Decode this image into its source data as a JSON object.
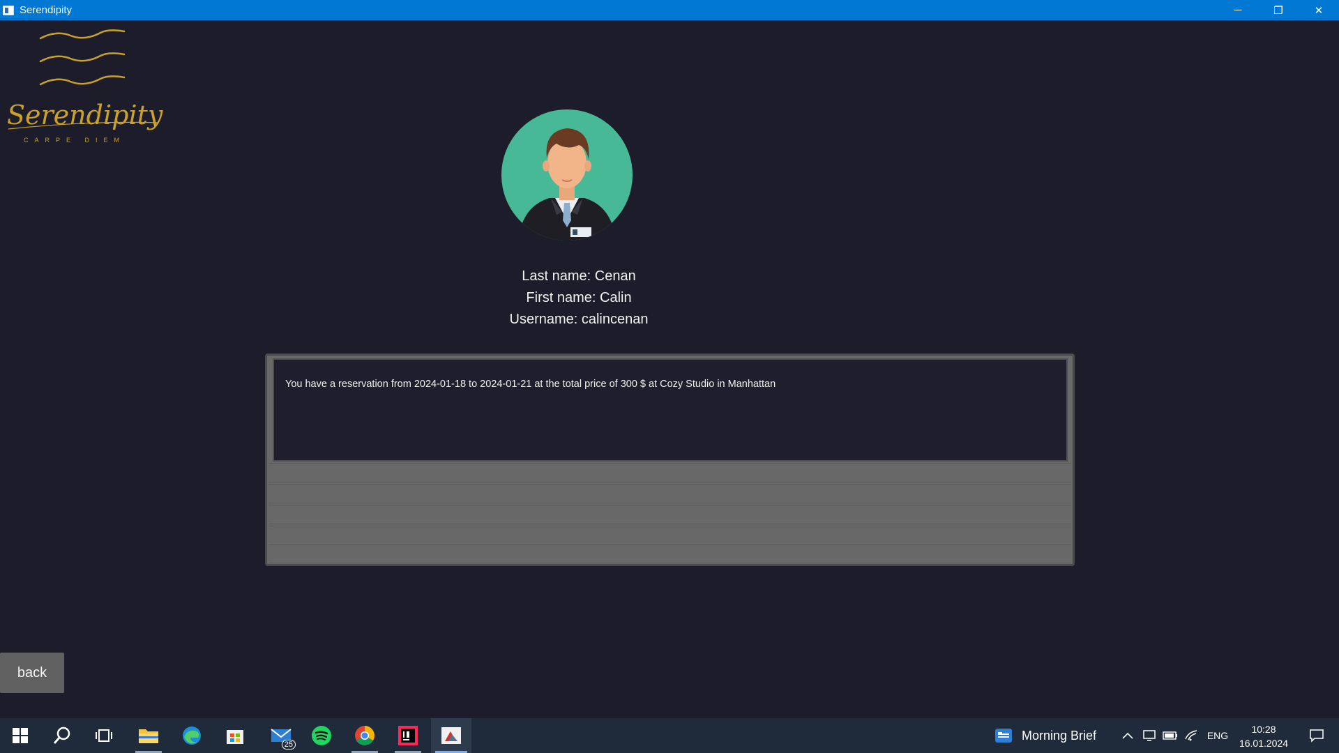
{
  "window": {
    "title": "Serendipity",
    "controls": {
      "minimize": "─",
      "restore": "❐",
      "close": "✕"
    }
  },
  "logo": {
    "wordmark": "Serendipity",
    "tagline": "CARPE DIEM",
    "color": "#c9a227"
  },
  "profile": {
    "last_name": "Last name: Cenan",
    "first_name": "First name: Calin",
    "username": "Username: calincenan"
  },
  "reservations": [
    "You have a reservation from 2024-01-18 to 2024-01-21 at the total price of 300 $ at Cozy Studio in Manhattan"
  ],
  "back_label": "back",
  "taskbar": {
    "apps": [
      {
        "name": "start-icon"
      },
      {
        "name": "search-icon"
      },
      {
        "name": "task-view-icon"
      },
      {
        "name": "file-explorer-icon"
      },
      {
        "name": "edge-icon"
      },
      {
        "name": "store-icon"
      },
      {
        "name": "mail-icon",
        "badge": "25"
      },
      {
        "name": "spotify-icon"
      },
      {
        "name": "chrome-icon"
      },
      {
        "name": "intellij-icon"
      },
      {
        "name": "java-app-icon"
      }
    ],
    "news_label": "Morning Brief",
    "language": "ENG",
    "time": "10:28",
    "date": "16.01.2024"
  },
  "colors": {
    "titlebar": "#0078d4",
    "background": "#1c1c2a",
    "taskbar": "#1f2b3a"
  }
}
